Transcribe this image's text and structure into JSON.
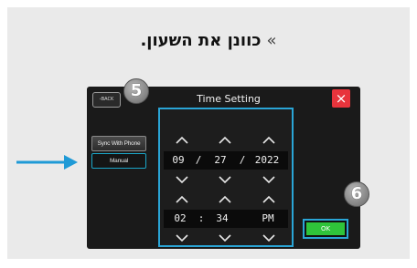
{
  "heading": {
    "text": "כוונן את השעון.",
    "chevron": "»"
  },
  "screen": {
    "title": "Time Setting",
    "back_label": "BACK",
    "close_icon": "×",
    "side_buttons": {
      "sync": "Sync With Phone",
      "manual": "Manual"
    },
    "date": {
      "month": "09",
      "sep1": "/",
      "day": "27",
      "sep2": "/",
      "year": "2022"
    },
    "time": {
      "hour": "02",
      "colon": ":",
      "minute": "34",
      "ampm": "PM"
    },
    "ok_label": "OK"
  },
  "callouts": {
    "step5": "5",
    "step6": "6"
  },
  "colors": {
    "highlight": "#2aa5d6",
    "ok_green": "#2fc43a",
    "close_red": "#e8343c",
    "pointer_blue": "#1f9ad6"
  },
  "icons": {
    "pointer": "arrow-right-icon",
    "increment": "chevron-up-icon",
    "decrement": "chevron-down-icon"
  }
}
